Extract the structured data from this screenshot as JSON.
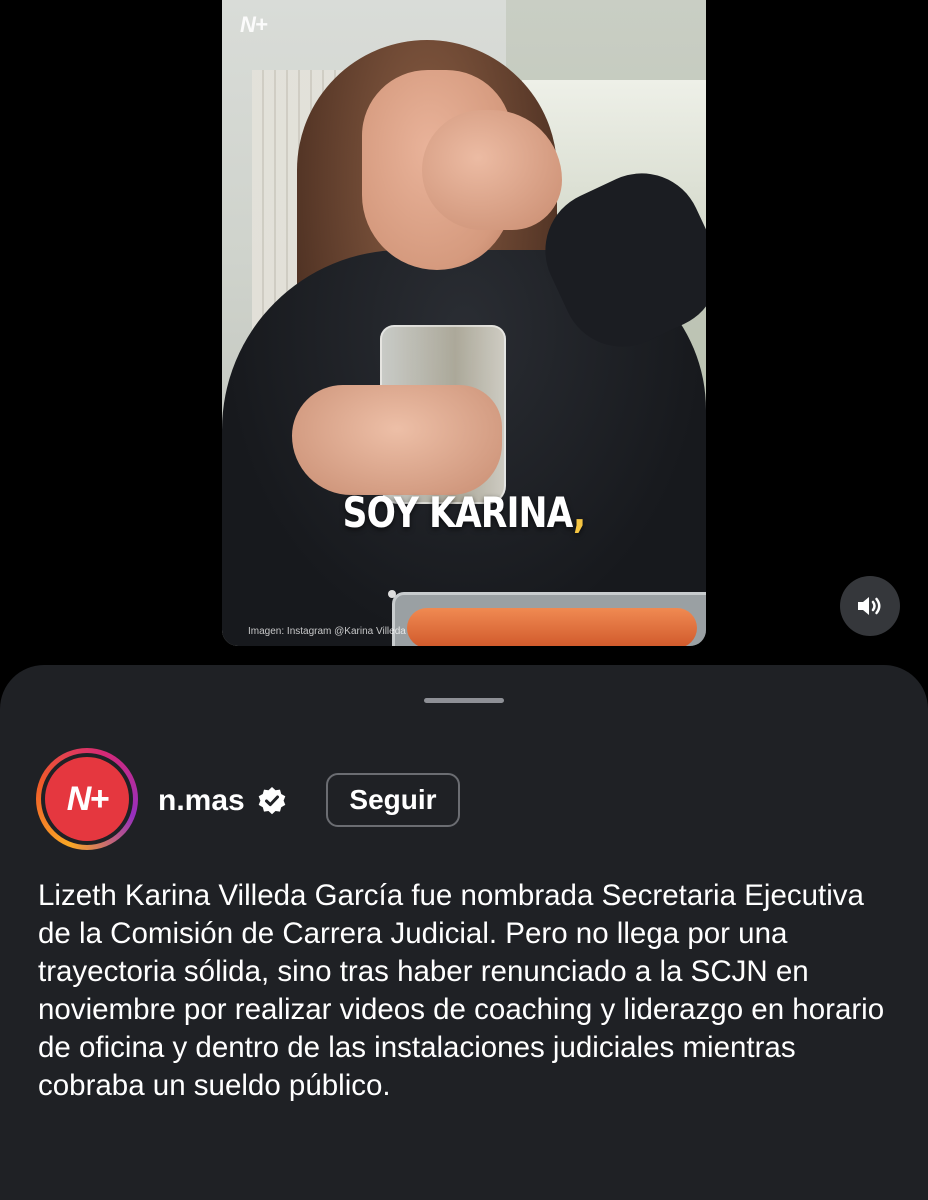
{
  "video": {
    "logo_text": "N+",
    "caption_main": "SOY KARINA",
    "caption_comma": ",",
    "credit": "Imagen: Instagram @Karina Villeda",
    "mute_icon": "speaker-icon"
  },
  "post": {
    "username": "n.mas",
    "avatar_text": "N+",
    "verified": true,
    "follow_label": "Seguir",
    "description": "Lizeth Karina Villeda García fue nombrada Secretaria Ejecutiva de la Comisión de Carrera Judicial. Pero no llega por una trayectoria sólida, sino tras haber renunciado a la SCJN en noviembre por realizar videos de coaching y liderazgo en horario de oficina y dentro de las instalaciones judiciales mientras cobraba un sueldo público."
  },
  "colors": {
    "background": "#000000",
    "sheet": "#1f2125",
    "brand_red": "#e5373f"
  }
}
